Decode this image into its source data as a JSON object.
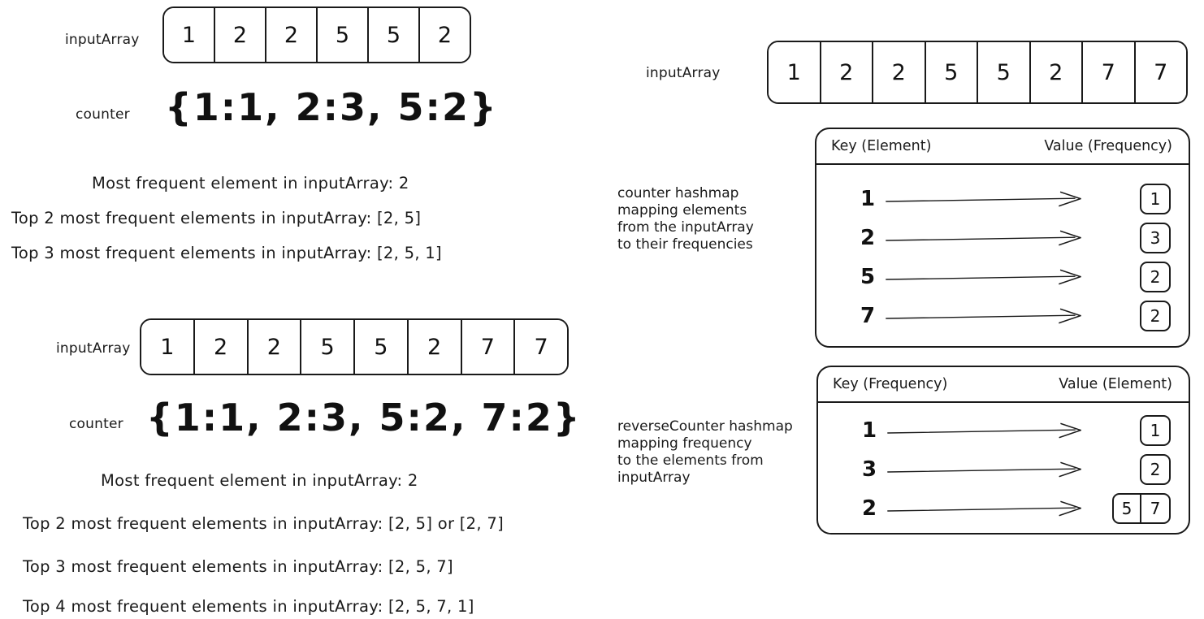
{
  "meta": {
    "title": "Most frequent element / top-K frequent elements with counter hashmap",
    "background_color": "#ffffff",
    "ink_color": "#1a1a1a"
  },
  "left_column": {
    "example_one": {
      "array_label": "inputArray",
      "array_values": [
        "1",
        "2",
        "2",
        "5",
        "5",
        "2"
      ],
      "counter_label": "counter",
      "counter_text": "{1:1,  2:3,  5:2}",
      "results": [
        "Most frequent element in inputArray: 2",
        "Top 2 most frequent elements in inputArray: [2, 5]",
        "Top 3 most frequent elements in inputArray: [2, 5, 1]"
      ]
    },
    "example_two": {
      "array_label": "inputArray",
      "array_values": [
        "1",
        "2",
        "2",
        "5",
        "5",
        "2",
        "7",
        "7"
      ],
      "counter_label": "counter",
      "counter_text": "{1:1,  2:3,  5:2,  7:2}",
      "results": [
        "Most frequent element in inputArray: 2",
        "Top 2 most frequent elements in inputArray: [2, 5] or [2, 7]",
        "Top 3 most frequent elements in inputArray: [2, 5, 7]",
        "Top 4 most frequent elements in inputArray: [2, 5, 7, 1]"
      ]
    }
  },
  "right_column": {
    "array_label": "inputArray",
    "array_values": [
      "1",
      "2",
      "2",
      "5",
      "5",
      "2",
      "7",
      "7"
    ],
    "counter_panel": {
      "annotation": "counter hashmap\nmapping elements\nfrom the inputArray\nto their frequencies",
      "key_header": "Key (Element)",
      "value_header": "Value (Frequency)",
      "rows": [
        {
          "key": "1",
          "values": [
            "1"
          ]
        },
        {
          "key": "2",
          "values": [
            "3"
          ]
        },
        {
          "key": "5",
          "values": [
            "2"
          ]
        },
        {
          "key": "7",
          "values": [
            "2"
          ]
        }
      ]
    },
    "reverse_counter_panel": {
      "annotation": "reverseCounter hashmap\nmapping frequency\nto the elements from\ninputArray",
      "key_header": "Key (Frequency)",
      "value_header": "Value (Element)",
      "rows": [
        {
          "key": "1",
          "values": [
            "1"
          ]
        },
        {
          "key": "3",
          "values": [
            "2"
          ]
        },
        {
          "key": "2",
          "values": [
            "5",
            "7"
          ]
        }
      ]
    }
  }
}
